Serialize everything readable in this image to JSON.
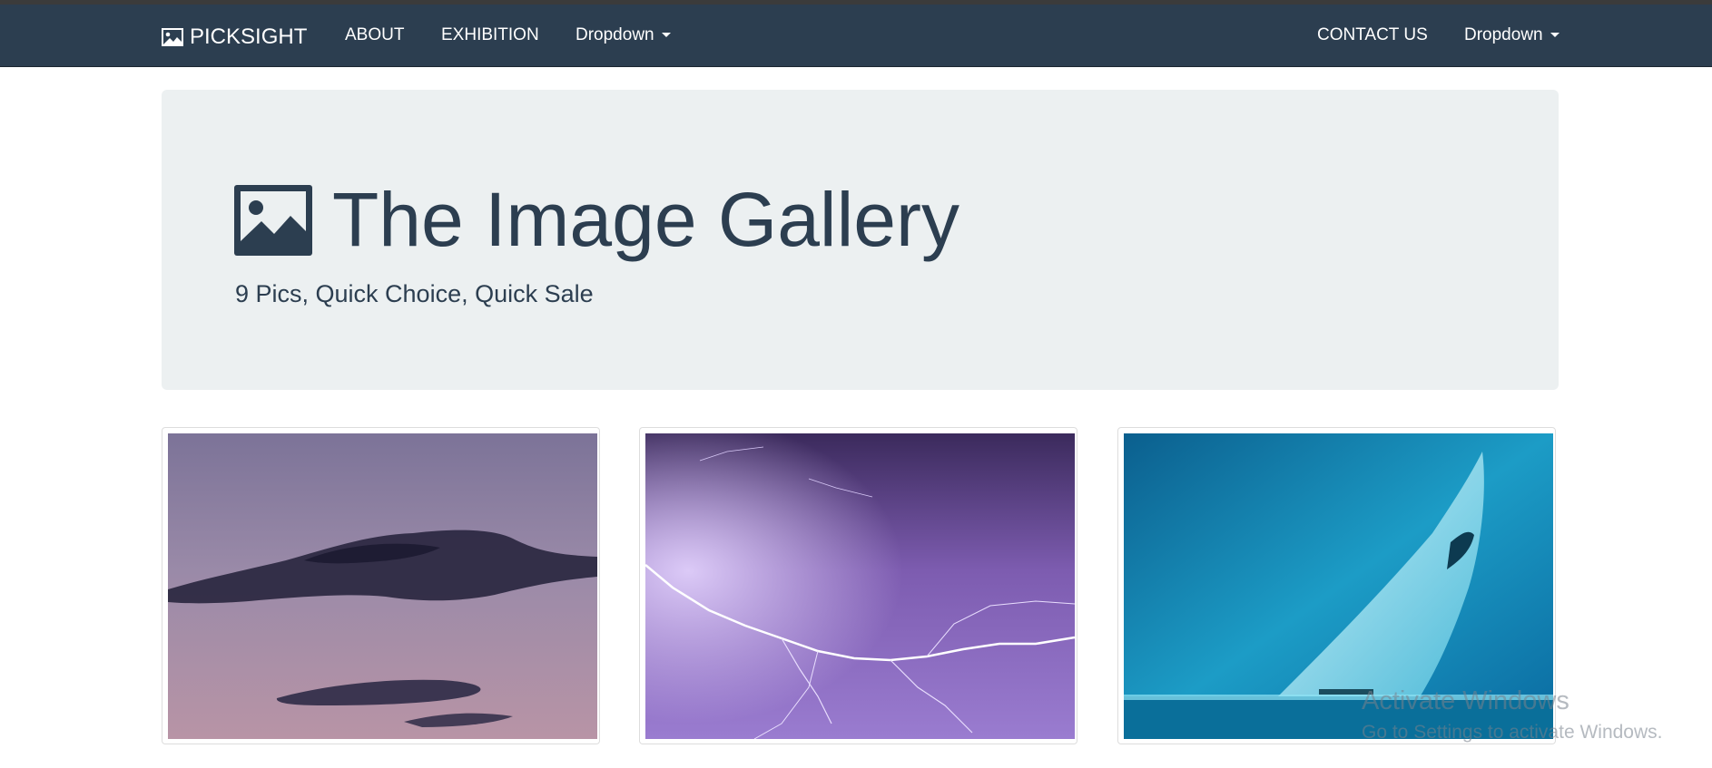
{
  "navbar": {
    "brand": "PICKSIGHT",
    "left_links": [
      "ABOUT",
      "EXHIBITION",
      "Dropdown"
    ],
    "right_links": [
      "CONTACT US",
      "Dropdown"
    ],
    "background_color": "#2c3e50"
  },
  "jumbotron": {
    "title": "The Image Gallery",
    "subtitle": "9 Pics, Quick Choice, Quick Sale",
    "icon": "image-icon",
    "background_color": "#ecf0f1"
  },
  "gallery": {
    "items": [
      {
        "icon": "dusk-clouds-photo",
        "alt": ""
      },
      {
        "icon": "lightning-photo",
        "alt": ""
      },
      {
        "icon": "ice-cave-photo",
        "alt": ""
      }
    ]
  },
  "overlay": {
    "watermark_title": "Activate Windows",
    "watermark_sub": "Go to Settings to activate Windows."
  }
}
